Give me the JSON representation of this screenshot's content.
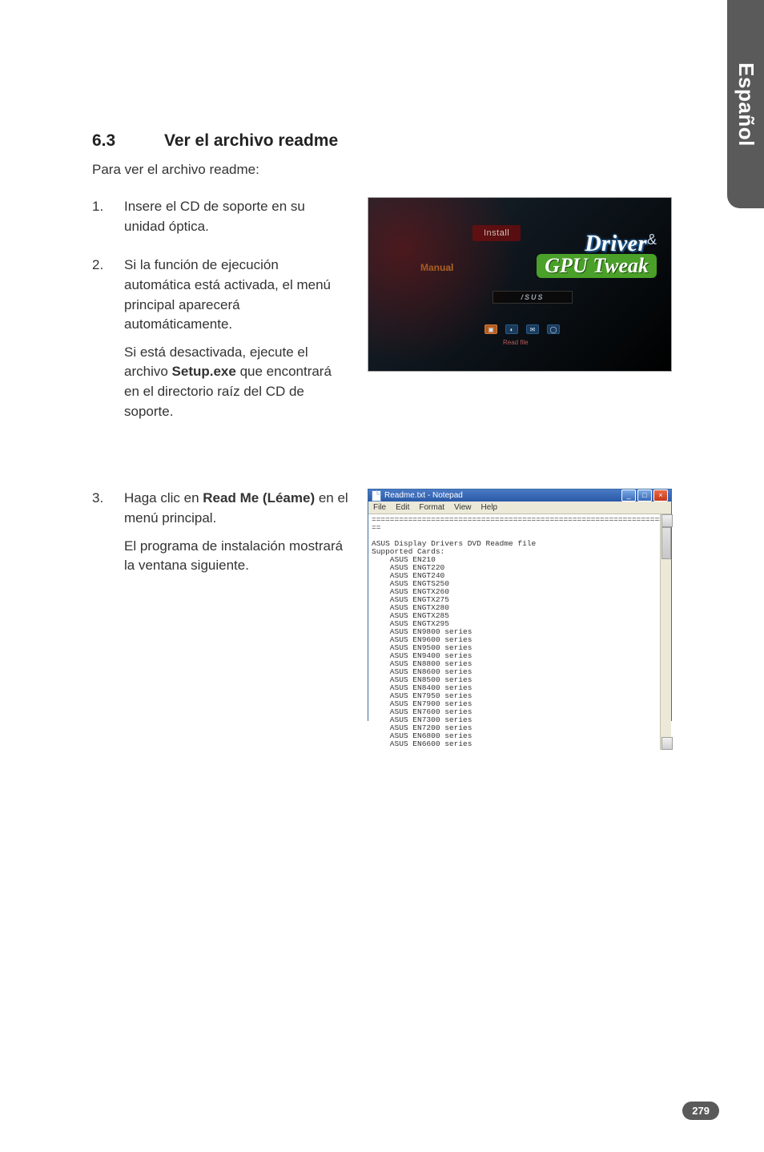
{
  "side_tab": "Español",
  "heading_num": "6.3",
  "heading_title": "Ver el archivo readme",
  "intro": "Para ver el archivo readme:",
  "steps": [
    {
      "num": "1.",
      "paras": [
        "Insere el CD de soporte en su unidad óptica."
      ]
    },
    {
      "num": "2.",
      "paras": [
        "Si la función de ejecución automática está activada, el menú principal aparecerá automáticamente.",
        "Si está desactivada, ejecute el archivo <b>Setup.exe</b> que encontrará en el directorio raíz del CD de soporte."
      ]
    },
    {
      "num": "3.",
      "paras": [
        "Haga clic en <b>Read Me (Léame)</b> en el menú principal.",
        "El programa de instalación mostrará la ventana siguiente."
      ]
    }
  ],
  "installer": {
    "install": "Install",
    "manual": "Manual",
    "wordmark_driver": "Driver",
    "wordmark_amp": "&",
    "wordmark_gpu": "GPU Tweak",
    "asus": "/SUS",
    "readfile": "Read file"
  },
  "notepad": {
    "title": "Readme.txt - Notepad",
    "menu": [
      "File",
      "Edit",
      "Format",
      "View",
      "Help"
    ],
    "body_lines": [
      "==================================================================",
      "==",
      "",
      "ASUS Display Drivers DVD Readme file",
      "Supported Cards:",
      "    ASUS EN210",
      "    ASUS ENGT220",
      "    ASUS ENGT240",
      "    ASUS ENGTS250",
      "    ASUS ENGTX260",
      "    ASUS ENGTX275",
      "    ASUS ENGTX280",
      "    ASUS ENGTX285",
      "    ASUS ENGTX295",
      "    ASUS EN9800 series",
      "    ASUS EN9600 series",
      "    ASUS EN9500 series",
      "    ASUS EN9400 series",
      "    ASUS EN8800 series",
      "    ASUS EN8600 series",
      "    ASUS EN8500 series",
      "    ASUS EN8400 series",
      "    ASUS EN7950 series",
      "    ASUS EN7900 series",
      "    ASUS EN7600 series",
      "    ASUS EN7300 series",
      "    ASUS EN7200 series",
      "    ASUS EN6800 series",
      "    ASUS EN6600 series"
    ]
  },
  "page_num": "279"
}
